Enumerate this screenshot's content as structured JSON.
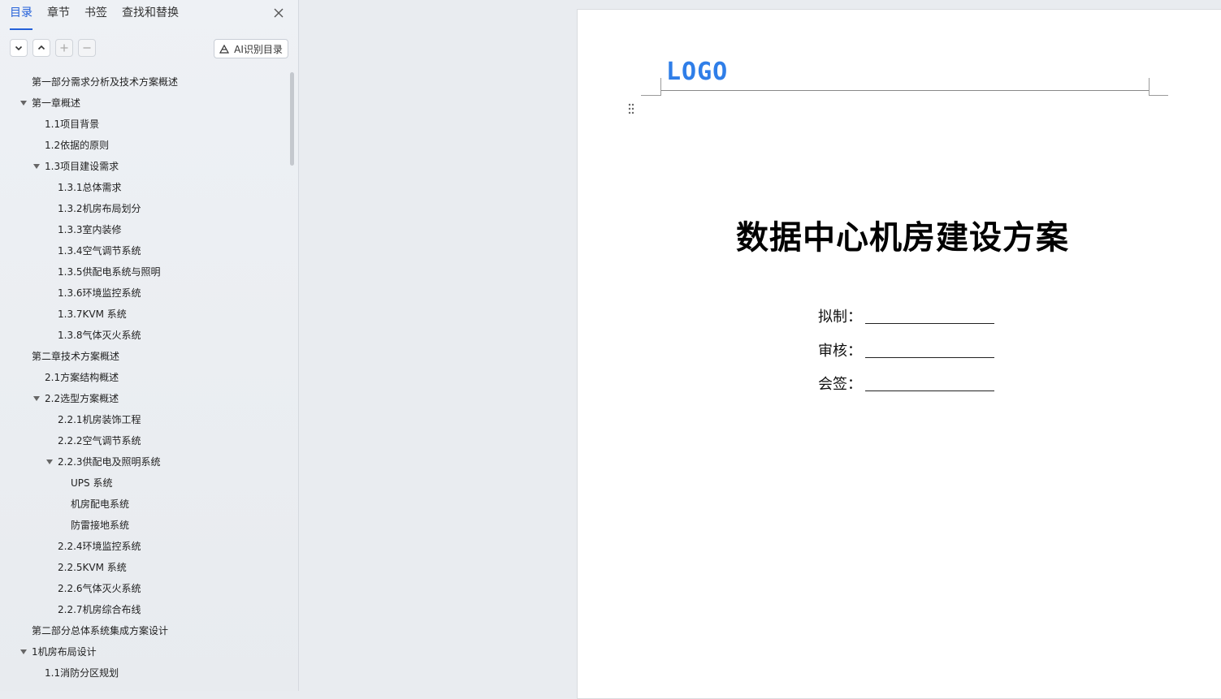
{
  "sidebar": {
    "tabs": [
      "目录",
      "章节",
      "书签",
      "查找和替换"
    ],
    "ai_button": "AI识别目录",
    "toc": [
      {
        "label": "第一部分需求分析及技术方案概述",
        "level": 0,
        "caret": false
      },
      {
        "label": "第一章概述",
        "level": 0,
        "caret": true
      },
      {
        "label": "1.1项目背景",
        "level": 1,
        "caret": false
      },
      {
        "label": "1.2依据的原则",
        "level": 1,
        "caret": false
      },
      {
        "label": "1.3项目建设需求",
        "level": 1,
        "caret": true
      },
      {
        "label": "1.3.1总体需求",
        "level": 2,
        "caret": false
      },
      {
        "label": "1.3.2机房布局划分",
        "level": 2,
        "caret": false
      },
      {
        "label": "1.3.3室内装修",
        "level": 2,
        "caret": false
      },
      {
        "label": "1.3.4空气调节系统",
        "level": 2,
        "caret": false
      },
      {
        "label": "1.3.5供配电系统与照明",
        "level": 2,
        "caret": false
      },
      {
        "label": "1.3.6环境监控系统",
        "level": 2,
        "caret": false
      },
      {
        "label": "1.3.7KVM 系统",
        "level": 2,
        "caret": false
      },
      {
        "label": "1.3.8气体灭火系统",
        "level": 2,
        "caret": false
      },
      {
        "label": "第二章技术方案概述",
        "level": 0,
        "caret": false
      },
      {
        "label": "2.1方案结构概述",
        "level": 1,
        "caret": false
      },
      {
        "label": "2.2选型方案概述",
        "level": 1,
        "caret": true
      },
      {
        "label": "2.2.1机房装饰工程",
        "level": 2,
        "caret": false
      },
      {
        "label": "2.2.2空气调节系统",
        "level": 2,
        "caret": false
      },
      {
        "label": "2.2.3供配电及照明系统",
        "level": 2,
        "caret": true
      },
      {
        "label": "UPS 系统",
        "level": 3,
        "caret": false
      },
      {
        "label": "机房配电系统",
        "level": 3,
        "caret": false
      },
      {
        "label": "防雷接地系统",
        "level": 3,
        "caret": false
      },
      {
        "label": "2.2.4环境监控系统",
        "level": 2,
        "caret": false
      },
      {
        "label": "2.2.5KVM 系统",
        "level": 2,
        "caret": false
      },
      {
        "label": "2.2.6气体灭火系统",
        "level": 2,
        "caret": false
      },
      {
        "label": "2.2.7机房综合布线",
        "level": 2,
        "caret": false
      },
      {
        "label": "第二部分总体系统集成方案设计",
        "level": 0,
        "caret": false
      },
      {
        "label": "1机房布局设计",
        "level": 0,
        "caret": true
      },
      {
        "label": "1.1消防分区规划",
        "level": 1,
        "caret": false
      }
    ]
  },
  "document": {
    "logo": "LOGO",
    "title": "数据中心机房建设方案",
    "sign_fields": [
      "拟制：",
      "审核：",
      "会签："
    ]
  },
  "colors": {
    "accent": "#2561d9",
    "logo": "#2f7ee8"
  }
}
